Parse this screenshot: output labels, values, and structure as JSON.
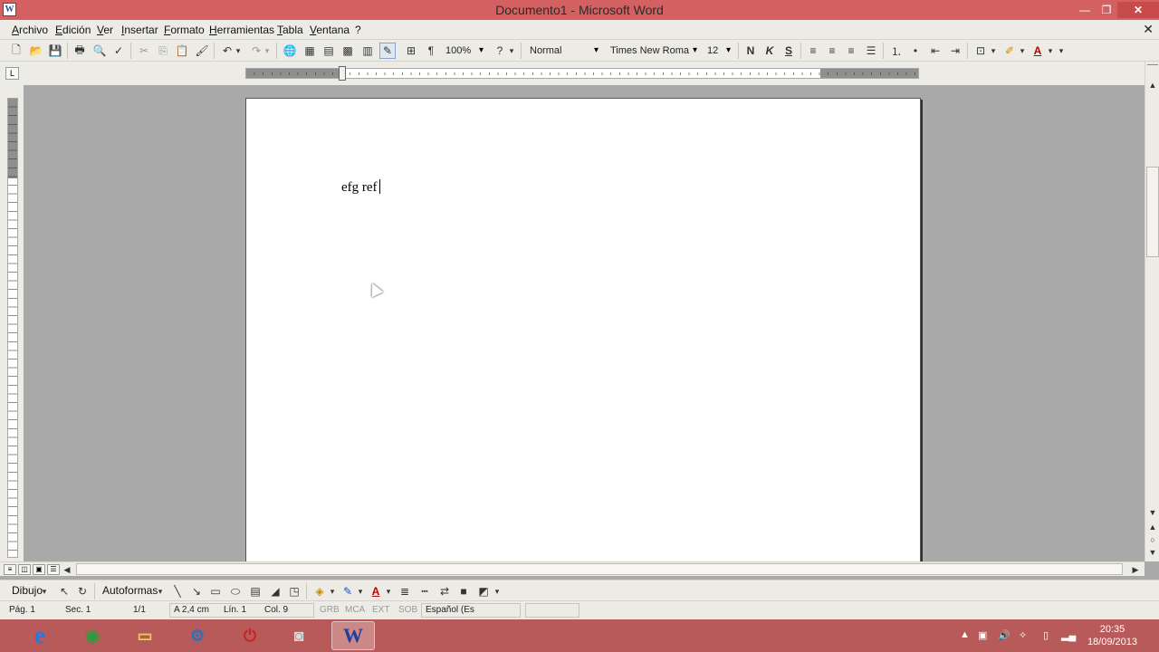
{
  "window": {
    "title": "Documento1 - Microsoft Word",
    "app_icon": "W",
    "minimize_glyph": "—",
    "restore_glyph": "❐",
    "close_glyph": "✕"
  },
  "menu": {
    "items": [
      "Archivo",
      "Edición",
      "Ver",
      "Insertar",
      "Formato",
      "Herramientas",
      "Tabla",
      "Ventana",
      "?"
    ],
    "doc_close": "✕"
  },
  "toolbar": {
    "zoom": "100%",
    "style": "Normal",
    "font": "Times New Roma",
    "size": "12",
    "bold": "N",
    "italic": "K",
    "underline": "S"
  },
  "ruler": {
    "tab_selector": "L"
  },
  "document": {
    "text": "efg ref"
  },
  "drawing": {
    "dibujo": "Dibujo",
    "autoformas": "Autoformas"
  },
  "status": {
    "page": "Pág. 1",
    "section": "Sec. 1",
    "pages": "1/1",
    "position": "A 2,4 cm",
    "line": "Lín. 1",
    "column": "Col. 9",
    "grb": "GRB",
    "mca": "MCA",
    "ext": "EXT",
    "sob": "SOB",
    "language": "Español (Es"
  },
  "taskbar": {
    "apps": [
      {
        "name": "internet-explorer",
        "glyph": "e",
        "color": "#1e7be0"
      },
      {
        "name": "chrome",
        "glyph": "◉",
        "color": "#2f9b3f"
      },
      {
        "name": "file-explorer",
        "glyph": "▭",
        "color": "#e8c95a"
      },
      {
        "name": "control-panel",
        "glyph": "⚙",
        "color": "#2f6fb3"
      },
      {
        "name": "power",
        "glyph": "⏻",
        "color": "#c0281f"
      },
      {
        "name": "camera",
        "glyph": "◙",
        "color": "#d9d9d9"
      },
      {
        "name": "word",
        "glyph": "W",
        "color": "#1f3f9e"
      }
    ],
    "time": "20:35",
    "date": "18/09/2013"
  }
}
